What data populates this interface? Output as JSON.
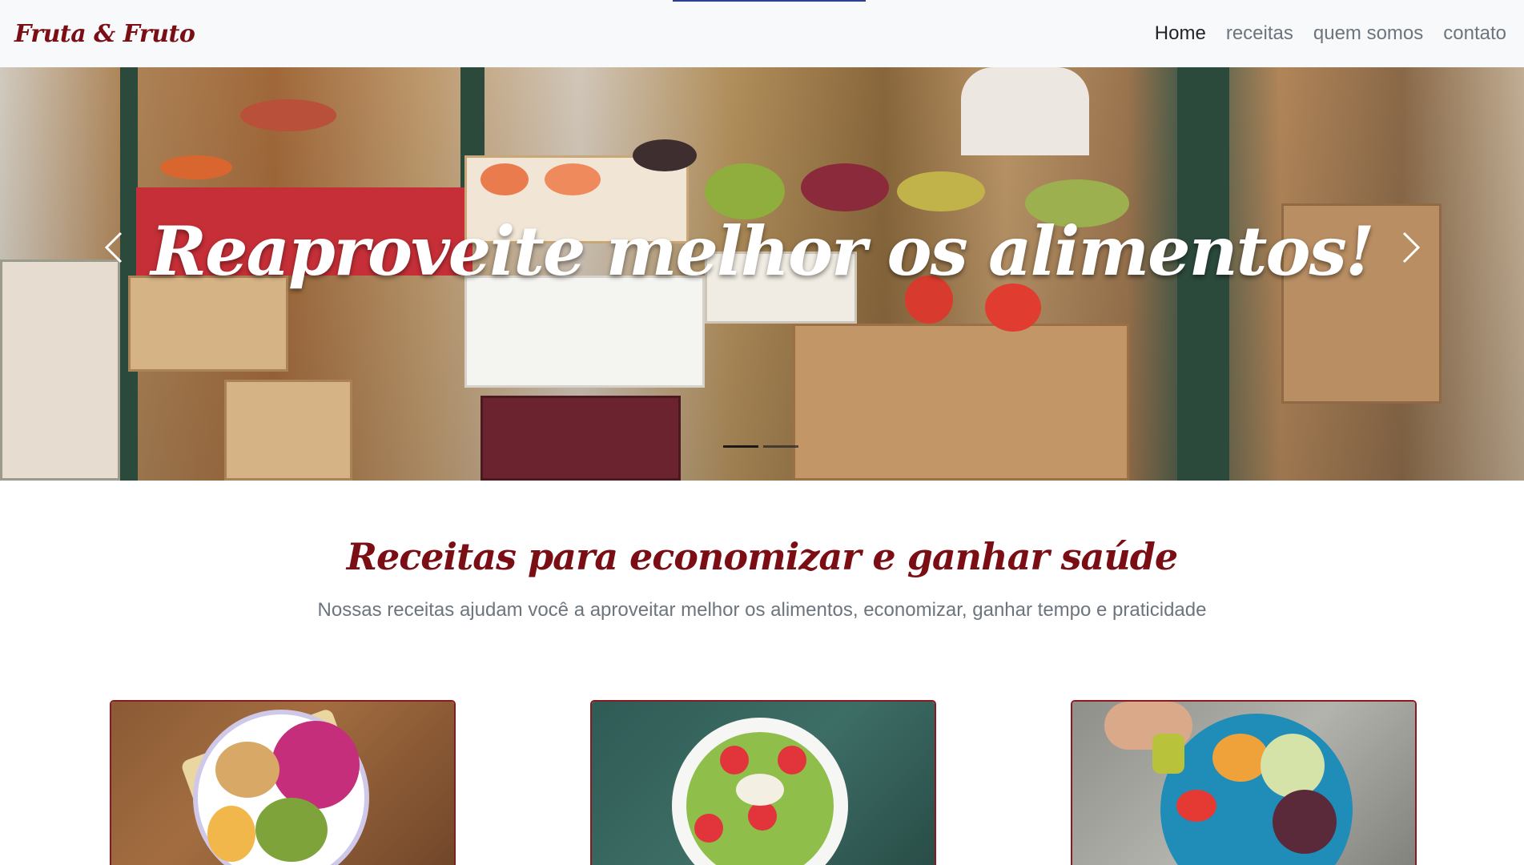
{
  "navbar": {
    "brand": "Fruta & Fruto",
    "links": [
      {
        "label": "Home",
        "active": true
      },
      {
        "label": "receitas",
        "active": false
      },
      {
        "label": "quem somos",
        "active": false
      },
      {
        "label": "contato",
        "active": false
      }
    ]
  },
  "carousel": {
    "caption": "Reaproveite melhor os alimentos!",
    "prev_icon": "chevron-left-icon",
    "next_icon": "chevron-right-icon",
    "slides_count": 2,
    "active_slide": 1
  },
  "section": {
    "title": "Receitas para economizar e ganhar saúde",
    "subtitle": "Nossas receitas ajudam você a aproveitar melhor os alimentos, economizar, ganhar tempo e praticidade"
  },
  "cards": [
    {
      "image": "acai-bowl-with-dragon-fruit"
    },
    {
      "image": "green-smoothie-bowl-with-strawberries"
    },
    {
      "image": "salad-plate-with-olive-oil"
    }
  ],
  "colors": {
    "brand": "#7b0d14",
    "nav_bg": "#f8f9fa",
    "nav_link": "#6c757d",
    "nav_active": "#212529",
    "card_border": "#8a1a20"
  }
}
